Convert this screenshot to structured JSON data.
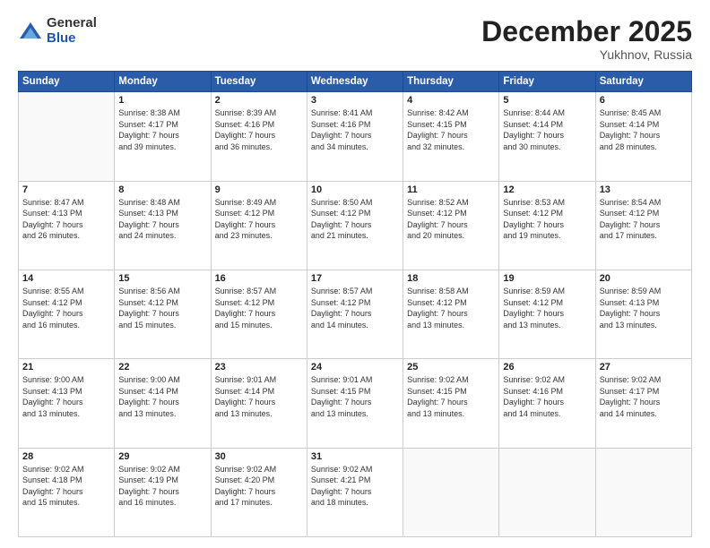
{
  "logo": {
    "general": "General",
    "blue": "Blue"
  },
  "header": {
    "month": "December 2025",
    "location": "Yukhnov, Russia"
  },
  "weekdays": [
    "Sunday",
    "Monday",
    "Tuesday",
    "Wednesday",
    "Thursday",
    "Friday",
    "Saturday"
  ],
  "weeks": [
    [
      {
        "day": "",
        "sunrise": "",
        "sunset": "",
        "daylight": ""
      },
      {
        "day": "1",
        "sunrise": "Sunrise: 8:38 AM",
        "sunset": "Sunset: 4:17 PM",
        "daylight": "Daylight: 7 hours and 39 minutes."
      },
      {
        "day": "2",
        "sunrise": "Sunrise: 8:39 AM",
        "sunset": "Sunset: 4:16 PM",
        "daylight": "Daylight: 7 hours and 36 minutes."
      },
      {
        "day": "3",
        "sunrise": "Sunrise: 8:41 AM",
        "sunset": "Sunset: 4:16 PM",
        "daylight": "Daylight: 7 hours and 34 minutes."
      },
      {
        "day": "4",
        "sunrise": "Sunrise: 8:42 AM",
        "sunset": "Sunset: 4:15 PM",
        "daylight": "Daylight: 7 hours and 32 minutes."
      },
      {
        "day": "5",
        "sunrise": "Sunrise: 8:44 AM",
        "sunset": "Sunset: 4:14 PM",
        "daylight": "Daylight: 7 hours and 30 minutes."
      },
      {
        "day": "6",
        "sunrise": "Sunrise: 8:45 AM",
        "sunset": "Sunset: 4:14 PM",
        "daylight": "Daylight: 7 hours and 28 minutes."
      }
    ],
    [
      {
        "day": "7",
        "sunrise": "Sunrise: 8:47 AM",
        "sunset": "Sunset: 4:13 PM",
        "daylight": "Daylight: 7 hours and 26 minutes."
      },
      {
        "day": "8",
        "sunrise": "Sunrise: 8:48 AM",
        "sunset": "Sunset: 4:13 PM",
        "daylight": "Daylight: 7 hours and 24 minutes."
      },
      {
        "day": "9",
        "sunrise": "Sunrise: 8:49 AM",
        "sunset": "Sunset: 4:12 PM",
        "daylight": "Daylight: 7 hours and 23 minutes."
      },
      {
        "day": "10",
        "sunrise": "Sunrise: 8:50 AM",
        "sunset": "Sunset: 4:12 PM",
        "daylight": "Daylight: 7 hours and 21 minutes."
      },
      {
        "day": "11",
        "sunrise": "Sunrise: 8:52 AM",
        "sunset": "Sunset: 4:12 PM",
        "daylight": "Daylight: 7 hours and 20 minutes."
      },
      {
        "day": "12",
        "sunrise": "Sunrise: 8:53 AM",
        "sunset": "Sunset: 4:12 PM",
        "daylight": "Daylight: 7 hours and 19 minutes."
      },
      {
        "day": "13",
        "sunrise": "Sunrise: 8:54 AM",
        "sunset": "Sunset: 4:12 PM",
        "daylight": "Daylight: 7 hours and 17 minutes."
      }
    ],
    [
      {
        "day": "14",
        "sunrise": "Sunrise: 8:55 AM",
        "sunset": "Sunset: 4:12 PM",
        "daylight": "Daylight: 7 hours and 16 minutes."
      },
      {
        "day": "15",
        "sunrise": "Sunrise: 8:56 AM",
        "sunset": "Sunset: 4:12 PM",
        "daylight": "Daylight: 7 hours and 15 minutes."
      },
      {
        "day": "16",
        "sunrise": "Sunrise: 8:57 AM",
        "sunset": "Sunset: 4:12 PM",
        "daylight": "Daylight: 7 hours and 15 minutes."
      },
      {
        "day": "17",
        "sunrise": "Sunrise: 8:57 AM",
        "sunset": "Sunset: 4:12 PM",
        "daylight": "Daylight: 7 hours and 14 minutes."
      },
      {
        "day": "18",
        "sunrise": "Sunrise: 8:58 AM",
        "sunset": "Sunset: 4:12 PM",
        "daylight": "Daylight: 7 hours and 13 minutes."
      },
      {
        "day": "19",
        "sunrise": "Sunrise: 8:59 AM",
        "sunset": "Sunset: 4:12 PM",
        "daylight": "Daylight: 7 hours and 13 minutes."
      },
      {
        "day": "20",
        "sunrise": "Sunrise: 8:59 AM",
        "sunset": "Sunset: 4:13 PM",
        "daylight": "Daylight: 7 hours and 13 minutes."
      }
    ],
    [
      {
        "day": "21",
        "sunrise": "Sunrise: 9:00 AM",
        "sunset": "Sunset: 4:13 PM",
        "daylight": "Daylight: 7 hours and 13 minutes."
      },
      {
        "day": "22",
        "sunrise": "Sunrise: 9:00 AM",
        "sunset": "Sunset: 4:14 PM",
        "daylight": "Daylight: 7 hours and 13 minutes."
      },
      {
        "day": "23",
        "sunrise": "Sunrise: 9:01 AM",
        "sunset": "Sunset: 4:14 PM",
        "daylight": "Daylight: 7 hours and 13 minutes."
      },
      {
        "day": "24",
        "sunrise": "Sunrise: 9:01 AM",
        "sunset": "Sunset: 4:15 PM",
        "daylight": "Daylight: 7 hours and 13 minutes."
      },
      {
        "day": "25",
        "sunrise": "Sunrise: 9:02 AM",
        "sunset": "Sunset: 4:15 PM",
        "daylight": "Daylight: 7 hours and 13 minutes."
      },
      {
        "day": "26",
        "sunrise": "Sunrise: 9:02 AM",
        "sunset": "Sunset: 4:16 PM",
        "daylight": "Daylight: 7 hours and 14 minutes."
      },
      {
        "day": "27",
        "sunrise": "Sunrise: 9:02 AM",
        "sunset": "Sunset: 4:17 PM",
        "daylight": "Daylight: 7 hours and 14 minutes."
      }
    ],
    [
      {
        "day": "28",
        "sunrise": "Sunrise: 9:02 AM",
        "sunset": "Sunset: 4:18 PM",
        "daylight": "Daylight: 7 hours and 15 minutes."
      },
      {
        "day": "29",
        "sunrise": "Sunrise: 9:02 AM",
        "sunset": "Sunset: 4:19 PM",
        "daylight": "Daylight: 7 hours and 16 minutes."
      },
      {
        "day": "30",
        "sunrise": "Sunrise: 9:02 AM",
        "sunset": "Sunset: 4:20 PM",
        "daylight": "Daylight: 7 hours and 17 minutes."
      },
      {
        "day": "31",
        "sunrise": "Sunrise: 9:02 AM",
        "sunset": "Sunset: 4:21 PM",
        "daylight": "Daylight: 7 hours and 18 minutes."
      },
      {
        "day": "",
        "sunrise": "",
        "sunset": "",
        "daylight": ""
      },
      {
        "day": "",
        "sunrise": "",
        "sunset": "",
        "daylight": ""
      },
      {
        "day": "",
        "sunrise": "",
        "sunset": "",
        "daylight": ""
      }
    ]
  ]
}
